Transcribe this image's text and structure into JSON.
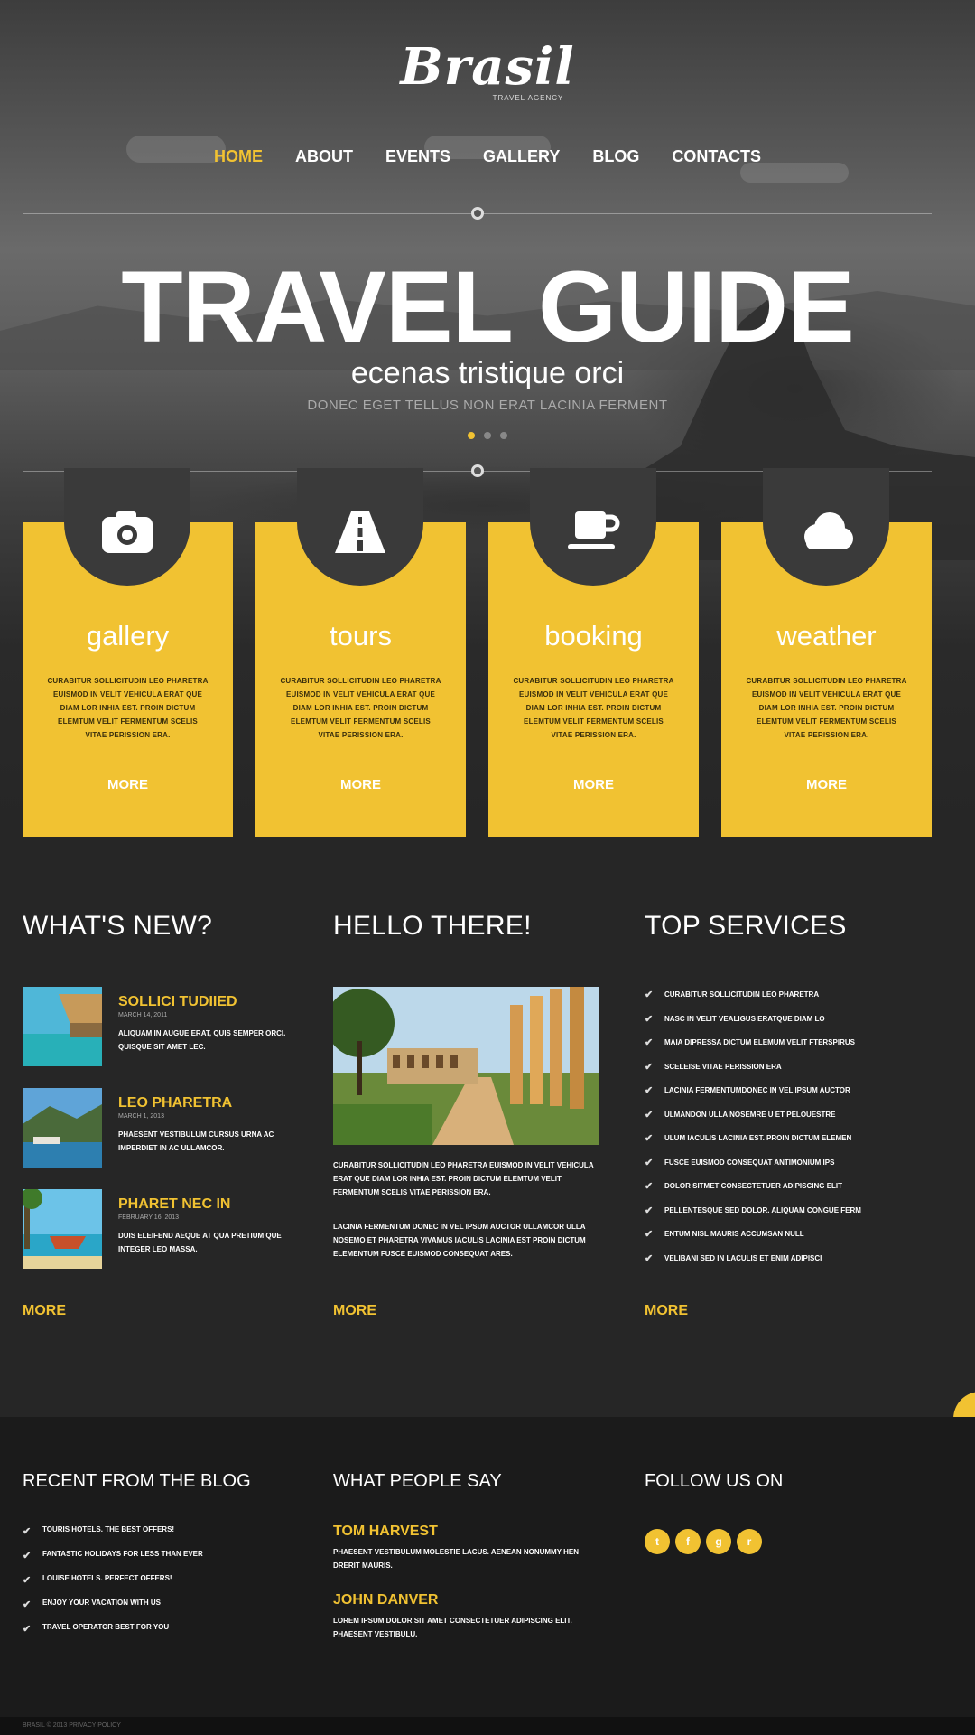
{
  "brand": {
    "name": "Brasil",
    "tagline": "TRAVEL AGENCY"
  },
  "nav": [
    {
      "label": "HOME",
      "active": true
    },
    {
      "label": "ABOUT",
      "active": false
    },
    {
      "label": "EVENTS",
      "active": false
    },
    {
      "label": "GALLERY",
      "active": false
    },
    {
      "label": "BLOG",
      "active": false
    },
    {
      "label": "CONTACTS",
      "active": false
    }
  ],
  "hero": {
    "title": "TRAVEL GUIDE",
    "subtitle": "ecenas tristique orci",
    "caption": "DONEC EGET TELLUS NON ERAT LACINIA FERMENT",
    "slides": 3,
    "active_slide": 1
  },
  "cards": [
    {
      "icon": "camera-icon",
      "title": "gallery",
      "text": "CURABITUR SOLLICITUDIN LEO PHARETRA EUISMOD IN VELIT VEHICULA ERAT QUE DIAM LOR INHIA EST. PROIN DICTUM ELEMTUM VELIT FERMENTUM SCELIS VITAE PERISSION ERA.",
      "more": "MORE"
    },
    {
      "icon": "road-icon",
      "title": "tours",
      "text": "CURABITUR SOLLICITUDIN LEO PHARETRA EUISMOD IN VELIT VEHICULA ERAT QUE DIAM LOR INHIA EST. PROIN DICTUM ELEMTUM VELIT FERMENTUM SCELIS VITAE PERISSION ERA.",
      "more": "MORE"
    },
    {
      "icon": "coffee-cup-icon",
      "title": "booking",
      "text": "CURABITUR SOLLICITUDIN LEO PHARETRA EUISMOD IN VELIT VEHICULA ERAT QUE DIAM LOR INHIA EST. PROIN DICTUM ELEMTUM VELIT FERMENTUM SCELIS VITAE PERISSION ERA.",
      "more": "MORE"
    },
    {
      "icon": "cloud-icon",
      "title": "weather",
      "text": "CURABITUR SOLLICITUDIN LEO PHARETRA EUISMOD IN VELIT VEHICULA ERAT QUE DIAM LOR INHIA EST. PROIN DICTUM ELEMTUM VELIT FERMENTUM SCELIS VITAE PERISSION ERA.",
      "more": "MORE"
    }
  ],
  "whats_new": {
    "heading": "WHAT'S NEW?",
    "items": [
      {
        "title": "SOLLICI TUDIIED",
        "date": "MARCH 14, 2011",
        "text": "ALIQUAM IN AUGUE ERAT, QUIS SEMPER ORCI. QUISQUE SIT AMET LEC."
      },
      {
        "title": "LEO PHARETRA",
        "date": "MARCH 1, 2013",
        "text": "PHAESENT VESTIBULUM CURSUS URNA AC IMPERDIET IN AC ULLAMCOR."
      },
      {
        "title": "PHARET NEC IN",
        "date": "FEBRUARY 16, 2013",
        "text": "DUIS ELEIFEND AEQUE AT QUA PRETIUM QUE INTEGER LEO MASSA."
      }
    ],
    "more": "MORE"
  },
  "hello": {
    "heading": "HELLO THERE!",
    "para1": "CURABITUR SOLLICITUDIN LEO PHARETRA EUISMOD IN VELIT VEHICULA ERAT QUE DIAM LOR INHIA EST. PROIN DICTUM ELEMTUM VELIT FERMENTUM SCELIS VITAE PERISSION ERA.",
    "para2": "LACINIA FERMENTUM DONEC IN VEL IPSUM AUCTOR ULLAMCOR ULLA NOSEMO ET PHARETRA VIVAMUS IACULIS LACINIA EST PROIN DICTUM ELEMENTUM FUSCE EUISMOD CONSEQUAT ARES.",
    "more": "MORE"
  },
  "services": {
    "heading": "TOP SERVICES",
    "items": [
      "CURABITUR SOLLICITUDIN LEO PHARETRA",
      "NASC IN VELIT VEALIGUS ERATQUE DIAM LO",
      "MAIA DIPRESSA DICTUM ELEMUM VELIT FTERSPIRUS",
      "SCELEISE VITAE PERISSION ERA",
      "LACINIA FERMENTUMDONEC IN VEL IPSUM AUCTOR",
      "ULMANDON ULLA NOSEMRE U ET PELOUESTRE",
      "ULUM IACULIS LACINIA EST. PROIN DICTUM ELEMEN",
      "FUSCE EUISMOD CONSEQUAT ANTIMONIUM IPS",
      "DOLOR SITMET CONSECTETUER ADIPISCING ELIT",
      "PELLENTESQUE SED DOLOR. ALIQUAM CONGUE FERM",
      "ENTUM NISL MAURIS ACCUMSAN NULL",
      "VELIBANI SED IN LACULIS ET ENIM ADIPISCI"
    ],
    "more": "MORE"
  },
  "footer": {
    "blog_heading": "RECENT FROM THE BLOG",
    "blog_items": [
      "TOURIS HOTELS. THE BEST OFFERS!",
      "FANTASTIC HOLIDAYS FOR LESS THAN EVER",
      "LOUISE HOTELS. PERFECT OFFERS!",
      "ENJOY YOUR VACATION WITH US",
      "TRAVEL OPERATOR BEST FOR YOU"
    ],
    "people_heading": "WHAT PEOPLE SAY",
    "quotes": [
      {
        "name": "TOM HARVEST",
        "text": "PHAESENT VESTIBULUM MOLESTIE LACUS. AENEAN NONUMMY HEN DRERIT MAURIS."
      },
      {
        "name": "JOHN DANVER",
        "text": "LOREM IPSUM DOLOR SIT AMET CONSECTETUER ADIPISCING ELIT. PHAESENT VESTIBULU."
      }
    ],
    "follow_heading": "FOLLOW US ON",
    "social": [
      {
        "icon": "twitter-icon",
        "glyph": "t"
      },
      {
        "icon": "facebook-icon",
        "glyph": "f"
      },
      {
        "icon": "google-plus-icon",
        "glyph": "g"
      },
      {
        "icon": "rss-icon",
        "glyph": "r"
      }
    ],
    "copyright": "BRASIL © 2013 PRIVACY POLICY"
  },
  "colors": {
    "accent": "#f1c232",
    "dark": "#262626",
    "footer": "#1b1b1b"
  }
}
